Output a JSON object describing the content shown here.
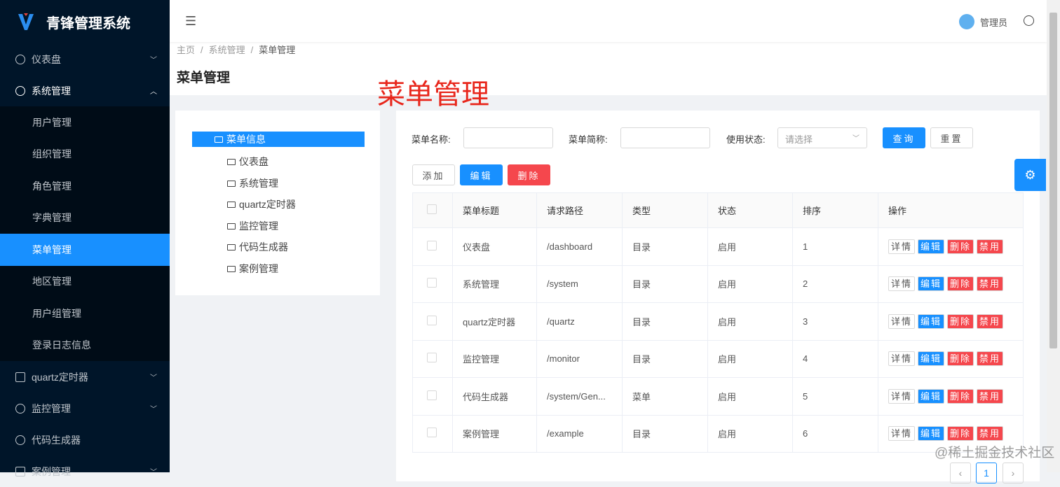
{
  "app": {
    "title": "青锋管理系统"
  },
  "sidebar": {
    "items": [
      {
        "label": "仪表盘"
      },
      {
        "label": "系统管理"
      },
      {
        "label": "quartz定时器"
      },
      {
        "label": "监控管理"
      },
      {
        "label": "代码生成器"
      },
      {
        "label": "案例管理"
      }
    ],
    "sub": [
      "用户管理",
      "组织管理",
      "角色管理",
      "字典管理",
      "菜单管理",
      "地区管理",
      "用户组管理",
      "登录日志信息"
    ]
  },
  "header": {
    "user": "管理员"
  },
  "breadcrumb": [
    "主页",
    "系统管理",
    "菜单管理"
  ],
  "page": {
    "title": "菜单管理",
    "annotation": "菜单管理"
  },
  "tree": {
    "root": "菜单信息",
    "children": [
      "仪表盘",
      "系统管理",
      "quartz定时器",
      "监控管理",
      "代码生成器",
      "案例管理"
    ]
  },
  "search": {
    "name_label": "菜单名称:",
    "short_label": "菜单简称:",
    "status_label": "使用状态:",
    "status_placeholder": "请选择",
    "query": "查询",
    "reset": "重置"
  },
  "toolbar": {
    "add": "添加",
    "edit": "编辑",
    "delete": "删除"
  },
  "table": {
    "headers": [
      "菜单标题",
      "请求路径",
      "类型",
      "状态",
      "排序",
      "操作"
    ],
    "rows": [
      {
        "title": "仪表盘",
        "path": "/dashboard",
        "type": "目录",
        "status": "启用",
        "sort": "1"
      },
      {
        "title": "系统管理",
        "path": "/system",
        "type": "目录",
        "status": "启用",
        "sort": "2"
      },
      {
        "title": "quartz定时器",
        "path": "/quartz",
        "type": "目录",
        "status": "启用",
        "sort": "3"
      },
      {
        "title": "监控管理",
        "path": "/monitor",
        "type": "目录",
        "status": "启用",
        "sort": "4"
      },
      {
        "title": "代码生成器",
        "path": "/system/Gen...",
        "type": "菜单",
        "status": "启用",
        "sort": "5"
      },
      {
        "title": "案例管理",
        "path": "/example",
        "type": "目录",
        "status": "启用",
        "sort": "6"
      }
    ],
    "actions": {
      "detail": "详情",
      "edit": "编辑",
      "delete": "删除",
      "disable": "禁用"
    }
  },
  "pagination": {
    "prev": "‹",
    "current": "1",
    "next": "›"
  },
  "watermark": "@稀土掘金技术社区"
}
